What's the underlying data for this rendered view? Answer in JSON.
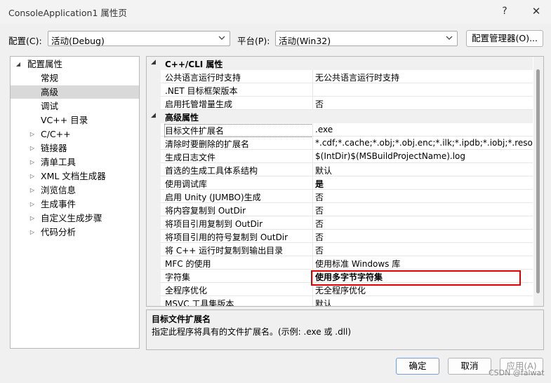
{
  "window": {
    "title": "ConsoleApplication1 属性页",
    "help": "?",
    "close": "✕"
  },
  "config": {
    "config_label": "配置(C):",
    "config_value": "活动(Debug)",
    "platform_label": "平台(P):",
    "platform_value": "活动(Win32)",
    "manager_button": "配置管理器(O)..."
  },
  "tree": {
    "root": "配置属性",
    "root_arrow": "◢",
    "items": [
      {
        "label": "常规",
        "arrow": ""
      },
      {
        "label": "高级",
        "arrow": ""
      },
      {
        "label": "调试",
        "arrow": ""
      },
      {
        "label": "VC++ 目录",
        "arrow": ""
      },
      {
        "label": "C/C++",
        "arrow": "▷"
      },
      {
        "label": "链接器",
        "arrow": "▷"
      },
      {
        "label": "清单工具",
        "arrow": "▷"
      },
      {
        "label": "XML 文档生成器",
        "arrow": "▷"
      },
      {
        "label": "浏览信息",
        "arrow": "▷"
      },
      {
        "label": "生成事件",
        "arrow": "▷"
      },
      {
        "label": "自定义生成步骤",
        "arrow": "▷"
      },
      {
        "label": "代码分析",
        "arrow": "▷"
      }
    ],
    "selected_index": 1
  },
  "grid": {
    "categories": [
      {
        "name": "C++/CLI 属性",
        "arrow": "◢",
        "rows": [
          {
            "name": "公共语言运行时支持",
            "value": "无公共语言运行时支持"
          },
          {
            "name": ".NET 目标框架版本",
            "value": ""
          },
          {
            "name": "启用托管增量生成",
            "value": "否"
          }
        ]
      },
      {
        "name": "高级属性",
        "arrow": "◢",
        "rows": [
          {
            "name": "目标文件扩展名",
            "value": ".exe",
            "selected": true
          },
          {
            "name": "清除时要删除的扩展名",
            "value": "*.cdf;*.cache;*.obj;*.obj.enc;*.ilk;*.ipdb;*.iobj;*.resource"
          },
          {
            "name": "生成日志文件",
            "value": "$(IntDir)$(MSBuildProjectName).log"
          },
          {
            "name": "首选的生成工具体系结构",
            "value": "默认"
          },
          {
            "name": "使用调试库",
            "value": "是",
            "bold": true
          },
          {
            "name": "启用 Unity (JUMBO)生成",
            "value": "否"
          },
          {
            "name": "将内容复制到 OutDir",
            "value": "否"
          },
          {
            "name": "将项目引用复制到 OutDir",
            "value": "否"
          },
          {
            "name": "将项目引用的符号复制到 OutDir",
            "value": "否"
          },
          {
            "name": "将 C++ 运行时复制到输出目录",
            "value": "否"
          },
          {
            "name": "MFC 的使用",
            "value": "使用标准 Windows 库"
          },
          {
            "name": "字符集",
            "value": "使用多字节字符集",
            "bold": true
          },
          {
            "name": "全程序优化",
            "value": "无全程序优化"
          },
          {
            "name": "MSVC 工具集版本",
            "value": "默认"
          }
        ]
      }
    ]
  },
  "description": {
    "title": "目标文件扩展名",
    "text": "指定此程序将具有的文件扩展名。(示例: .exe 或 .dll)"
  },
  "buttons": {
    "ok": "确定",
    "cancel": "取消",
    "apply": "应用(A)"
  },
  "watermark": "CSDN @falwat"
}
